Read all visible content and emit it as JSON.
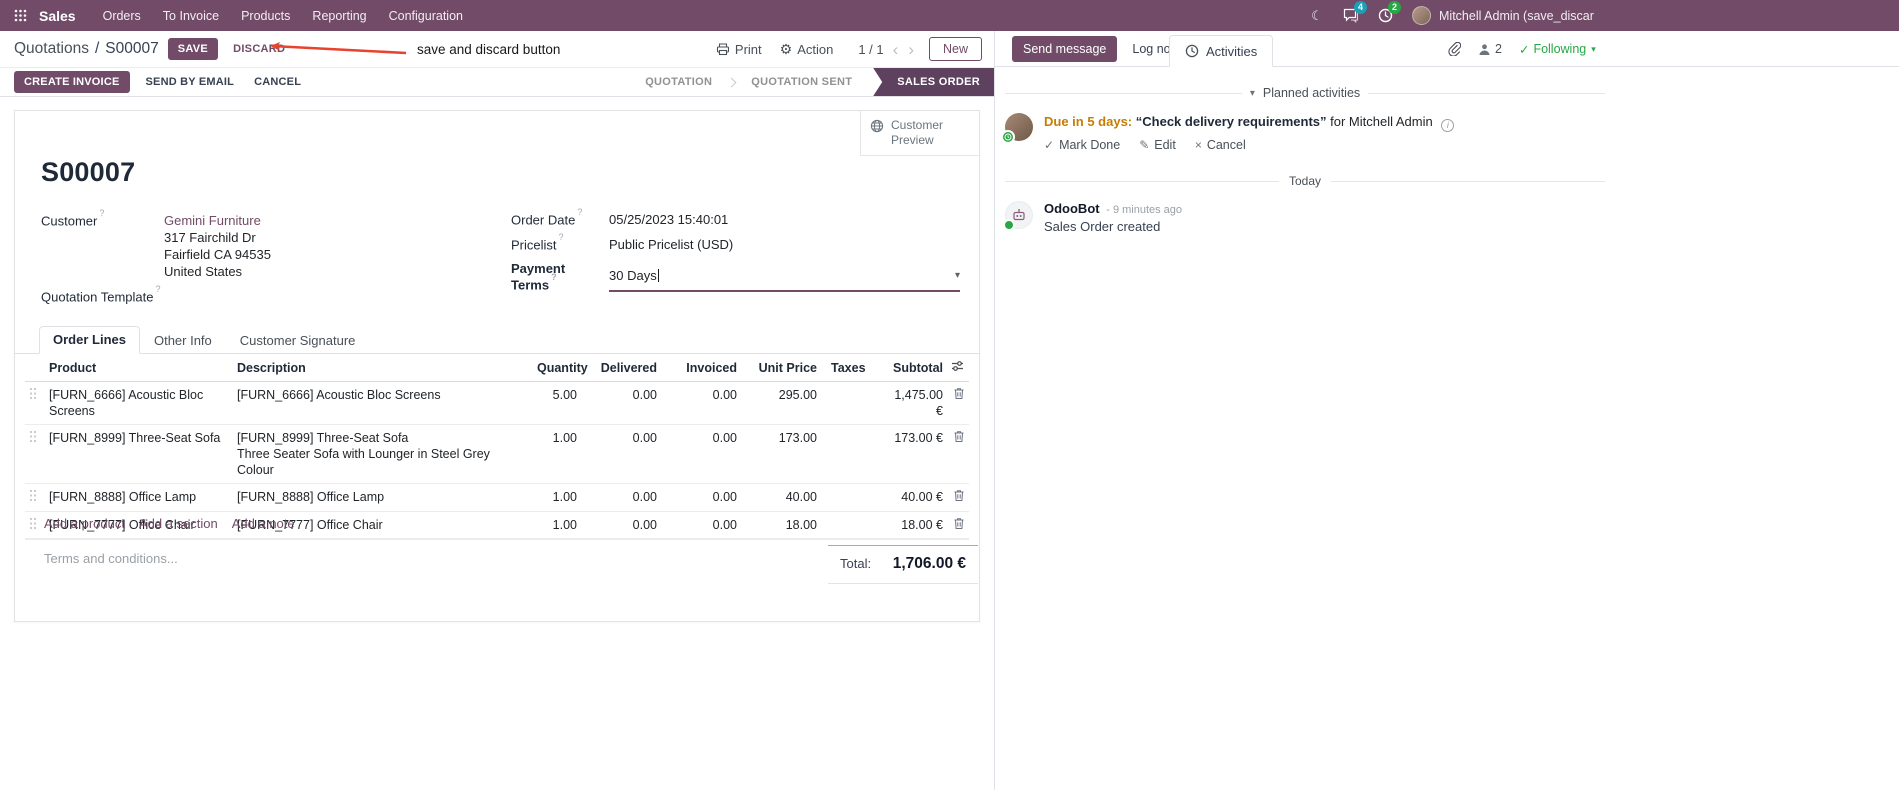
{
  "colors": {
    "brand": "#714B67",
    "state_active_bg": "#5e415e",
    "annotation_red": "#e8432c",
    "highlight_blue": "#2671d9",
    "following_green": "#28a745",
    "due_orange": "#c77d00",
    "message_badge_bg": "#17a2b8",
    "activity_badge_bg": "#28a745"
  },
  "glyphs": {
    "moon": "☾",
    "gear": "⚙",
    "caret_down": "▾",
    "prev": "‹",
    "next": "›",
    "check": "✓",
    "pencil": "✎",
    "cross": "×",
    "question": "?",
    "info": "i"
  },
  "navbar": {
    "app_name": "Sales",
    "menus": [
      "Orders",
      "To Invoice",
      "Products",
      "Reporting",
      "Configuration"
    ],
    "message_badge": "4",
    "activity_badge": "2",
    "user_name": "Mitchell Admin (save_discar"
  },
  "control_panel": {
    "breadcrumb_parent": "Quotations",
    "breadcrumb_sep": "/",
    "breadcrumb_current": "S00007",
    "save": "SAVE",
    "discard": "DISCARD",
    "print": "Print",
    "action": "Action",
    "pager": "1 / 1",
    "new": "New"
  },
  "annotation": {
    "text": "save and discard button"
  },
  "statusbar": {
    "create_invoice": "CREATE INVOICE",
    "send_by_email": "SEND BY EMAIL",
    "cancel": "CANCEL",
    "states": [
      {
        "label": "QUOTATION",
        "active": false
      },
      {
        "label": "QUOTATION SENT",
        "active": false
      },
      {
        "label": "SALES ORDER",
        "active": true
      }
    ]
  },
  "sheet": {
    "customer_preview": "Customer Preview",
    "title": "S00007",
    "customer_label": "Customer",
    "customer_name": "Gemini Furniture",
    "address_line1": "317 Fairchild Dr",
    "address_line2": "Fairfield CA 94535",
    "address_line3": "United States",
    "quotation_template_label": "Quotation Template",
    "order_date_label": "Order Date",
    "order_date": "05/25/2023 15:40:01",
    "pricelist_label": "Pricelist",
    "pricelist": "Public Pricelist (USD)",
    "payment_terms_label": "Payment Terms",
    "payment_terms": "30 Days",
    "tabs": [
      {
        "label": "Order Lines",
        "active": true
      },
      {
        "label": "Other Info",
        "active": false
      },
      {
        "label": "Customer Signature",
        "active": false
      }
    ],
    "table": {
      "col_product": "Product",
      "col_description": "Description",
      "col_quantity": "Quantity",
      "col_delivered": "Delivered",
      "col_invoiced": "Invoiced",
      "col_unit_price": "Unit Price",
      "col_taxes": "Taxes",
      "col_subtotal": "Subtotal",
      "rows": [
        {
          "product": "[FURN_6666] Acoustic Bloc Screens",
          "description": "[FURN_6666] Acoustic Bloc Screens",
          "quantity": "5.00",
          "delivered": "0.00",
          "invoiced": "0.00",
          "unit_price": "295.00",
          "taxes": "",
          "subtotal": "1,475.00 €"
        },
        {
          "product": "[FURN_8999] Three-Seat Sofa",
          "description": "[FURN_8999] Three-Seat Sofa",
          "description2": "Three Seater Sofa with Lounger in Steel Grey Colour",
          "quantity": "1.00",
          "delivered": "0.00",
          "invoiced": "0.00",
          "unit_price": "173.00",
          "taxes": "",
          "subtotal": "173.00 €"
        },
        {
          "product": "[FURN_8888] Office Lamp",
          "description": "[FURN_8888] Office Lamp",
          "quantity": "1.00",
          "delivered": "0.00",
          "invoiced": "0.00",
          "unit_price": "40.00",
          "taxes": "",
          "subtotal": "40.00 €"
        },
        {
          "product": "[FURN_7777] Office Chair",
          "description": "[FURN_7777] Office Chair",
          "quantity": "1.00",
          "delivered": "0.00",
          "invoiced": "0.00",
          "unit_price": "18.00",
          "taxes": "",
          "subtotal": "18.00 €"
        }
      ],
      "add_product": "Add a product",
      "add_section": "Add a section",
      "add_note": "Add a note"
    },
    "terms_placeholder": "Terms and conditions...",
    "total_label": "Total:",
    "total_value": "1,706.00 €"
  },
  "chatter": {
    "send_message": "Send message",
    "log_note": "Log note",
    "activities": "Activities",
    "followers_count": "2",
    "following": "Following",
    "planned_header": "Planned activities",
    "activity_due": "Due in 5 days:",
    "activity_summary": "“Check delivery requirements”",
    "activity_for": "for Mitchell Admin",
    "mark_done": "Mark Done",
    "edit": "Edit",
    "cancel": "Cancel",
    "today": "Today",
    "message_author": "OdooBot",
    "message_time": "- 9 minutes ago",
    "message_body": "Sales Order created"
  }
}
